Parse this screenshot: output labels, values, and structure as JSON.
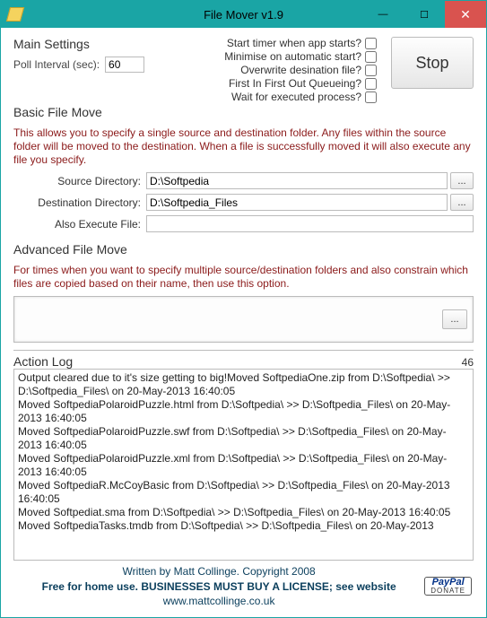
{
  "window": {
    "title": "File Mover v1.9"
  },
  "mainSettings": {
    "heading": "Main Settings",
    "pollLabel": "Poll Interval (sec):",
    "pollValue": "60"
  },
  "options": {
    "startTimer": "Start timer when app starts?",
    "minimise": "Minimise on automatic start?",
    "overwrite": "Overwrite desination file?",
    "fifo": "First In First Out Queueing?",
    "wait": "Wait for executed process?"
  },
  "stopLabel": "Stop",
  "basic": {
    "heading": "Basic File Move",
    "desc": "This allows you to specify a single source and destination folder. Any files within the source folder will be moved to the destination. When a file is successfully moved it will also execute any file you specify.",
    "srcLabel": "Source Directory:",
    "srcValue": "D:\\Softpedia",
    "destLabel": "Destination Directory:",
    "destValue": "D:\\Softpedia_Files",
    "execLabel": "Also Execute File:",
    "execValue": ""
  },
  "advanced": {
    "heading": "Advanced File Move",
    "desc": "For times when you want to specify multiple source/destination folders and also constrain which files are copied based on their name, then use this option."
  },
  "browseLabel": "...",
  "log": {
    "heading": "Action Log",
    "count": "46",
    "entries": [
      "Output cleared due to it's size getting to big!Moved SoftpediaOne.zip from D:\\Softpedia\\ >> D:\\Softpedia_Files\\  on 20-May-2013 16:40:05",
      "Moved SoftpediaPolaroidPuzzle.html from D:\\Softpedia\\ >> D:\\Softpedia_Files\\  on 20-May-2013 16:40:05",
      "Moved SoftpediaPolaroidPuzzle.swf from D:\\Softpedia\\ >> D:\\Softpedia_Files\\  on 20-May-2013 16:40:05",
      "Moved SoftpediaPolaroidPuzzle.xml from D:\\Softpedia\\ >> D:\\Softpedia_Files\\  on 20-May-2013 16:40:05",
      "Moved SoftpediaR.McCoyBasic from D:\\Softpedia\\ >> D:\\Softpedia_Files\\  on 20-May-2013 16:40:05",
      "Moved Softpediat.sma from D:\\Softpedia\\ >> D:\\Softpedia_Files\\  on 20-May-2013 16:40:05",
      "Moved SoftpediaTasks.tmdb from D:\\Softpedia\\ >> D:\\Softpedia_Files\\  on 20-May-2013"
    ]
  },
  "footer": {
    "line1": "Written by Matt Collinge. Copyright 2008",
    "line2": "Free for home use. BUSINESSES MUST BUY A LICENSE; see website",
    "line3": "www.mattcollinge.co.uk",
    "paypal": "PayPal",
    "donate": "DONATE"
  }
}
